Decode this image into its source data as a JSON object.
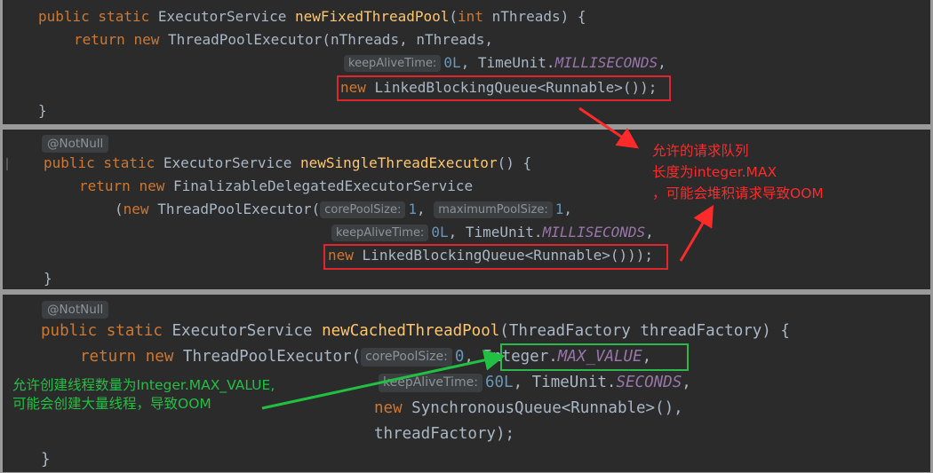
{
  "blocks": {
    "fixed": {
      "line1": {
        "mods": "public static",
        "type": "ExecutorService",
        "name": "newFixedThreadPool",
        "params_open": "(",
        "ptype": "int",
        "pname": " nThreads) {"
      },
      "line2": {
        "ret": "return",
        "new": "new",
        "call": "ThreadPoolExecutor(nThreads, nThreads,"
      },
      "line3": {
        "hint": "keepAliveTime:",
        "num": "0L",
        "sep": ", TimeUnit.",
        "const": "MILLISECONDS",
        "end": ","
      },
      "line4": {
        "new": "new",
        "rest": "LinkedBlockingQueue<Runnable>());"
      },
      "close": "}"
    },
    "single": {
      "annotation": "@NotNull",
      "line1": {
        "mods": "public static",
        "type": "ExecutorService",
        "name": "newSingleThreadExecutor",
        "rest": "() {"
      },
      "line2": {
        "ret": "return",
        "new": "new",
        "call": "FinalizableDelegatedExecutorService"
      },
      "line3": {
        "open": "(",
        "new": "new",
        "call": "ThreadPoolExecutor(",
        "hint1": "corePoolSize:",
        "num1": "1",
        "comma": ",",
        "hint2": "maximumPoolSize:",
        "num2": "1",
        "end": ","
      },
      "line4": {
        "hint": "keepAliveTime:",
        "num": "0L",
        "sep": ", TimeUnit.",
        "const": "MILLISECONDS",
        "end": ","
      },
      "line5": {
        "new": "new",
        "rest": "LinkedBlockingQueue<Runnable>()));"
      },
      "close": "}"
    },
    "cached": {
      "annotation": "@NotNull",
      "line1": {
        "mods": "public static",
        "type": "ExecutorService",
        "name": "newCachedThreadPool",
        "rest": "(ThreadFactory threadFactory) {"
      },
      "line2": {
        "ret": "return",
        "new": "new",
        "call": "ThreadPoolExecutor(",
        "hint": "corePoolSize:",
        "num": "0",
        "comma": ",",
        "int": "Integer.",
        "const": "MAX_VALUE",
        "end": ","
      },
      "line3": {
        "hint": "keepAliveTime:",
        "num": "60L",
        "sep": ", TimeUnit.",
        "const": "SECONDS",
        "end": ","
      },
      "line4": {
        "new": "new",
        "rest": "SynchronousQueue<Runnable>(),"
      },
      "line5": "threadFactory);",
      "close": "}"
    }
  },
  "notes": {
    "red": "允许的请求队列\n长度为integer.MAX\n，可能会堆积请求导致OOM",
    "green": "允许创建线程数量为Integer.MAX_VALUE,\n可能会创建大量线程，导致OOM"
  },
  "colors": {
    "background": "#2b2b2b",
    "keyword": "#cc7832",
    "method": "#ffc66d",
    "number": "#6897bb",
    "constant": "#9876aa",
    "text": "#a9b7c6",
    "annotation_red": "#e0262c",
    "annotation_green": "#2db84d"
  }
}
